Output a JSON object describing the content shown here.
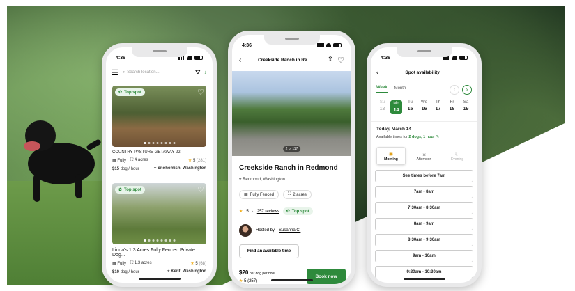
{
  "status_time": "4:36",
  "phone1": {
    "search_placeholder": "Search location...",
    "listings": [
      {
        "badge": "Top spot",
        "title": "COUNTRY PASTURE GETAWAY 22",
        "fence": "Fully",
        "acres": "4 acres",
        "rating": "5",
        "reviews": "(281)",
        "price": "$15",
        "unit": "dog / hour",
        "location": "Snohomish, Washington"
      },
      {
        "badge": "Top spot",
        "title": "Linda's 1.3 Acres Fully Fenced Private Dog...",
        "fence": "Fully",
        "acres": "1.3 acres",
        "rating": "5",
        "reviews": "(68)",
        "price": "$10",
        "unit": "dog / hour",
        "location": "Kent, Washington"
      }
    ]
  },
  "phone2": {
    "header_title": "Creekside Ranch in Re...",
    "photo_counter": "2 of 117",
    "title": "Creekside Ranch in Redmond",
    "location": "Redmond, Washington",
    "fence": "Fully Fenced",
    "acres": "2 acres",
    "rating": "5",
    "reviews": "257 reviews",
    "badge": "Top spot",
    "hosted_by": "Hosted by",
    "host_name": "Susanna C.",
    "find_time": "Find an available time",
    "price": "$20",
    "price_unit": "per dog per hour",
    "footer_rating": "5",
    "footer_reviews": "(257)",
    "book": "Book now"
  },
  "phone3": {
    "header_title": "Spot availability",
    "tab_week": "Week",
    "tab_month": "Month",
    "days": [
      {
        "name": "Su",
        "num": "13"
      },
      {
        "name": "Mo",
        "num": "14"
      },
      {
        "name": "Tu",
        "num": "15"
      },
      {
        "name": "We",
        "num": "16"
      },
      {
        "name": "Th",
        "num": "17"
      },
      {
        "name": "Fr",
        "num": "18"
      },
      {
        "name": "Sa",
        "num": "19"
      }
    ],
    "date_heading": "Today, March 14",
    "available_prefix": "Available times for",
    "available_detail": "2 dogs, 1 hour",
    "periods": [
      "Morning",
      "Afternoon",
      "Evening"
    ],
    "times": [
      "See times before 7am",
      "7am - 8am",
      "7:30am - 8:30am",
      "8am - 9am",
      "8:30am - 9:30am",
      "9am - 10am",
      "9:30am - 10:30am"
    ]
  },
  "colors": {
    "accent": "#2e8a3c"
  }
}
